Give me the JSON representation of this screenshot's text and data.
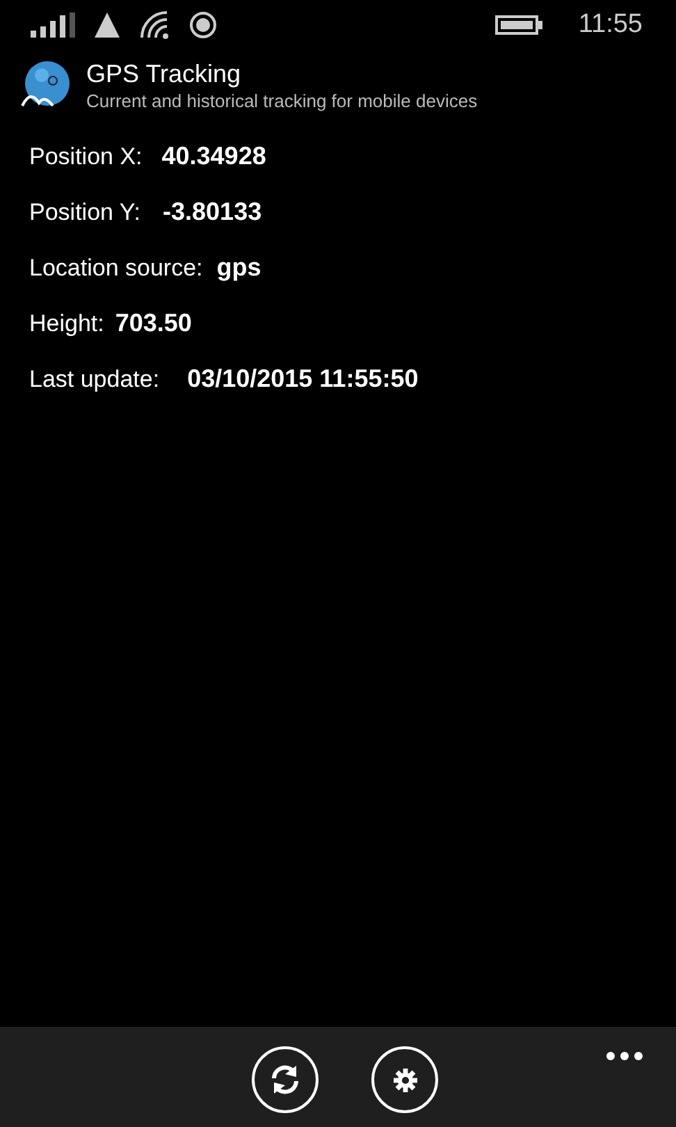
{
  "status_bar": {
    "time": "11:55"
  },
  "header": {
    "title": "GPS Tracking",
    "subtitle": "Current and historical tracking for mobile devices"
  },
  "fields": [
    {
      "label": "Position X:",
      "value": "40.34928"
    },
    {
      "label": "Position Y:",
      "value": "-3.80133"
    },
    {
      "label": "Location source:",
      "value": "gps"
    },
    {
      "label": "Height:",
      "value": "703.50"
    },
    {
      "label": "Last update:",
      "value": "03/10/2015 11:55:50"
    }
  ],
  "app_bar": {
    "buttons": [
      {
        "kind": "refresh"
      },
      {
        "kind": "settings"
      }
    ]
  }
}
